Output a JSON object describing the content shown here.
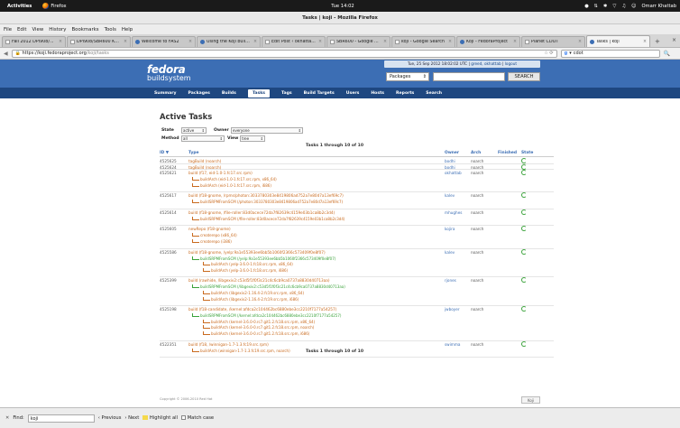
{
  "os": {
    "activities": "Activities",
    "app_name": "Firefox",
    "clock": "Tue 14:02",
    "user": "Omarr Khattab"
  },
  "window": {
    "title": "Tasks | koji - Mozilla Firefox"
  },
  "menu": [
    "File",
    "Edit",
    "View",
    "History",
    "Bookmarks",
    "Tools",
    "Help"
  ],
  "tabs": [
    {
      "label": "Fall 2012 DPI908/...",
      "active": false
    },
    {
      "label": "DPI908/SBR600 K...",
      "active": false
    },
    {
      "label": "Welcome to FAS2",
      "active": false
    },
    {
      "label": "Using the Koji build...",
      "active": false
    },
    {
      "label": "Edit Post ‹ okhatta...",
      "active": false
    },
    {
      "label": "SBR600 - Google ...",
      "active": false
    },
    {
      "label": "koji - Google Search",
      "active": false
    },
    {
      "label": "Koji - FedoraProject",
      "active": false
    },
    {
      "label": "Planet CDOT",
      "active": false
    },
    {
      "label": "Tasks | koji",
      "active": true
    }
  ],
  "urlbar": {
    "domain": "https://koji.fedoraproject.org",
    "path": "/koji/tasks"
  },
  "search": {
    "engine": "g",
    "value": "cdot"
  },
  "koji": {
    "logo_top": "fedora",
    "logo_bottom": "buildsystem",
    "login_prefix": "Tue, 25 Sep 2012 18:02:02 UTC | ",
    "login_user": "greed, okhattab",
    "login_sep": " | ",
    "logout": "logout",
    "search_select": "Packages",
    "search_button": "SEARCH",
    "nav": [
      "Summary",
      "Packages",
      "Builds",
      "Tasks",
      "Tags",
      "Build Targets",
      "Users",
      "Hosts",
      "Reports",
      "Search"
    ],
    "nav_active": "Tasks"
  },
  "page": {
    "title": "Active Tasks",
    "state_label": "State",
    "state_value": "active",
    "owner_label": "Owner",
    "owner_value": "everyone",
    "method_label": "Method",
    "method_value": "all",
    "view_label": "View",
    "view_value": "tree",
    "caption": "Tasks 1 through 10 of 10",
    "columns": [
      "ID ▼",
      "Type",
      "Owner",
      "Arch",
      "Finished",
      "State"
    ],
    "copyright": "Copyright © 2006-2010 Red Hat",
    "powered": "Koji"
  },
  "tasks": [
    {
      "id": "4525625",
      "type": "tagBuild (noarch)",
      "owner": "bodhi",
      "arch": "noarch",
      "subs": []
    },
    {
      "id": "4525624",
      "type": "tagBuild (noarch)",
      "owner": "bodhi",
      "arch": "noarch",
      "subs": []
    },
    {
      "id": "4525621",
      "type": "build (f17, eid-1.0-1.fc17.src.rpm)",
      "owner": "okhattab",
      "arch": "noarch",
      "subs": [
        {
          "text": "buildArch (eid-1.0-1.fc17.src.rpm, x86_64)",
          "c": "o",
          "lvl": 1
        },
        {
          "text": "buildArch (eid-1.0-1.fc17.src.rpm, i686)",
          "c": "o",
          "lvl": 1
        }
      ]
    },
    {
      "id": "4525617",
      "type": "build (f18-gnome, /rpms/photon:3033780303e8419806ad752a7e80d7a13ef69c7)",
      "owner": "kalev",
      "arch": "noarch",
      "subs": [
        {
          "text": "buildSRPMFromSCM (/photon:3033780303e8419806ad752a7e80d7a13ef69c7)",
          "c": "o",
          "lvl": 1
        }
      ]
    },
    {
      "id": "4525614",
      "type": "build (f18-gnome, /file-roller:83d0acece72da7f82639c4159e03b1ca8b2c3d4)",
      "owner": "mhughes",
      "arch": "noarch",
      "subs": [
        {
          "text": "buildSRPMFromSCM (/file-roller:83d0acece72da7f82639c4159e03b1ca8b2c3d4)",
          "c": "o",
          "lvl": 1
        }
      ]
    },
    {
      "id": "4525605",
      "type": "newRepo (f18-gnome)",
      "owner": "kojira",
      "arch": "noarch",
      "subs": [
        {
          "text": "createrepo (x86_64)",
          "c": "o",
          "lvl": 1
        },
        {
          "text": "createrepo (i386)",
          "c": "o",
          "lvl": 1
        }
      ]
    },
    {
      "id": "4525586",
      "type": "build (f18-gnome, /yelp:9a1e55393ee6bb5b1060f2366c573409f0e8f07)",
      "owner": "kalev",
      "arch": "noarch",
      "subs": [
        {
          "text": "buildSRPMFromSCM (/yelp:9a1e55393ee6bb5b1060f2366c573409f0e8f07)",
          "c": "g",
          "lvl": 1
        },
        {
          "text": "buildArch (yelp-3.6.0-1.fc18.src.rpm, x86_64)",
          "c": "o",
          "lvl": 2
        },
        {
          "text": "buildArch (yelp-3.6.0-1.fc18.src.rpm, i686)",
          "c": "o",
          "lvl": 2
        }
      ]
    },
    {
      "id": "4525399",
      "type": "build (rawhide, /libgexiv2:c53d5f1f0f3c21c4c6cb9ca0737a8830d40713aa)",
      "owner": "rjones",
      "arch": "noarch",
      "subs": [
        {
          "text": "buildSRPMFromSCM (/libgexiv2:c53d5f1f0f3c21c4c6cb9ca0737a8830d40713aa)",
          "c": "g",
          "lvl": 1
        },
        {
          "text": "buildArch (libgexiv2-1.16.4-2.fc19.src.rpm, x86_64)",
          "c": "o",
          "lvl": 2
        },
        {
          "text": "buildArch (libgexiv2-1.16.4-2.fc19.src.rpm, i686)",
          "c": "o",
          "lvl": 2
        }
      ]
    },
    {
      "id": "4525198",
      "type": "build (f18-candidate, /kernel:afdca2c104462bc6880ebe3cc2210f7177a54257)",
      "owner": "jwboyer",
      "arch": "noarch",
      "subs": [
        {
          "text": "buildSRPMFromSCM (/kernel:afdca2c104462bc6880ebe3cc2210f7177a54257)",
          "c": "g",
          "lvl": 1
        },
        {
          "text": "buildArch (kernel-3.6.0-0.rc7.git1.2.fc18.src.rpm, x86_64)",
          "c": "o",
          "lvl": 2
        },
        {
          "text": "buildArch (kernel-3.6.0-0.rc7.git1.2.fc18.src.rpm, noarch)",
          "c": "o",
          "lvl": 2
        },
        {
          "text": "buildArch (kernel-3.6.0-0.rc7.git1.2.fc18.src.rpm, i686)",
          "c": "o",
          "lvl": 2
        }
      ]
    },
    {
      "id": "4522351",
      "type": "build (f18, /winnigan-1.7-1.3.fc19.src.rpm)",
      "owner": "swimma",
      "arch": "noarch",
      "subs": [
        {
          "text": "buildArch (winnigan-1.7-1.3.fc19.src.rpm, noarch)",
          "c": "o",
          "lvl": 1
        }
      ]
    }
  ],
  "findbar": {
    "close": "✕",
    "label": "Find:",
    "value": "koji",
    "previous": "Previous",
    "next": "Next",
    "highlight": "Highlight all",
    "match_case": "Match case"
  }
}
